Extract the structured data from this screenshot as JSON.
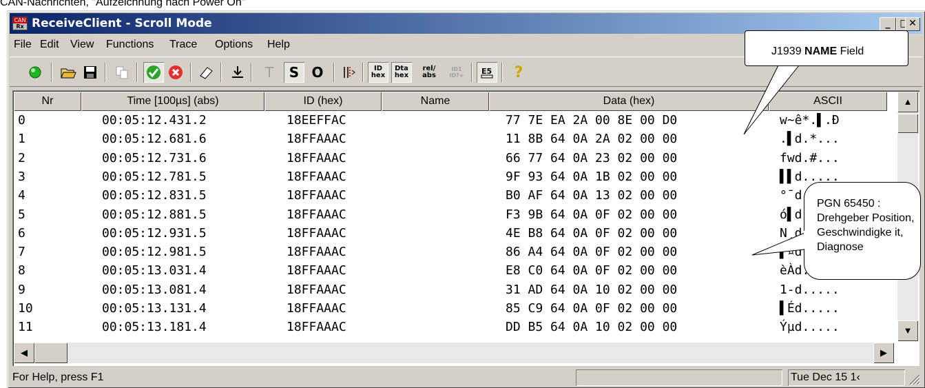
{
  "caption": "CAN-Nachrichten, \"Aufzeichnung nach Power On\"",
  "window": {
    "title": "ReceiveClient - Scroll Mode",
    "icon_text_top": "CAN",
    "icon_text_bottom": "Rx",
    "btn_minimize": "_",
    "btn_maximize": "□",
    "btn_close": "✕"
  },
  "menu": [
    "File",
    "Edit",
    "View",
    "Functions",
    "Trace",
    "Options",
    "Help"
  ],
  "toolbar": {
    "t_label": "T",
    "s_label": "S",
    "o_label": "O",
    "id_hex": [
      "ID",
      "hex"
    ],
    "dta_hex": [
      "Dta",
      "hex"
    ],
    "rel_abs": [
      "rel/",
      "abs"
    ],
    "id_plus": [
      "ID1",
      "ID?+"
    ],
    "help_glyph": "?"
  },
  "table": {
    "columns": [
      "Nr",
      "Time [100µs] (abs)",
      "ID (hex)",
      "Name",
      "Data (hex)",
      "ASCII"
    ],
    "rows": [
      {
        "nr": "0",
        "time": "00:05:12.431.2",
        "id": "18EEFFAC",
        "name": "",
        "data": "77 7E EA 2A 00 8E 00 D0",
        "ascii": "w~ê*.▌.Ð"
      },
      {
        "nr": "1",
        "time": "00:05:12.681.6",
        "id": "18FFAAAC",
        "name": "",
        "data": "11 8B 64 0A 2A 02 00 00",
        "ascii": ".▌d.*..."
      },
      {
        "nr": "2",
        "time": "00:05:12.731.6",
        "id": "18FFAAAC",
        "name": "",
        "data": "66 77 64 0A 23 02 00 00",
        "ascii": "fwd.#..."
      },
      {
        "nr": "3",
        "time": "00:05:12.781.5",
        "id": "18FFAAAC",
        "name": "",
        "data": "9F 93 64 0A 1B 02 00 00",
        "ascii": "▌▌d....."
      },
      {
        "nr": "4",
        "time": "00:05:12.831.5",
        "id": "18FFAAAC",
        "name": "",
        "data": "B0 AF 64 0A 13 02 00 00",
        "ascii": "°¯d....."
      },
      {
        "nr": "5",
        "time": "00:05:12.881.5",
        "id": "18FFAAAC",
        "name": "",
        "data": "F3 9B 64 0A 0F 02 00 00",
        "ascii": "ó▌d....."
      },
      {
        "nr": "6",
        "time": "00:05:12.931.5",
        "id": "18FFAAAC",
        "name": "",
        "data": "4E B8 64 0A 0F 02 00 00",
        "ascii": "N¸d....."
      },
      {
        "nr": "7",
        "time": "00:05:12.981.5",
        "id": "18FFAAAC",
        "name": "",
        "data": "86 A4 64 0A 0F 02 00 00",
        "ascii": "▌¤d....."
      },
      {
        "nr": "8",
        "time": "00:05:13.031.4",
        "id": "18FFAAAC",
        "name": "",
        "data": "E8 C0 64 0A 0F 02 00 00",
        "ascii": "èÀd....."
      },
      {
        "nr": "9",
        "time": "00:05:13.081.4",
        "id": "18FFAAAC",
        "name": "",
        "data": "31 AD 64 0A 10 02 00 00",
        "ascii": "1-d....."
      },
      {
        "nr": "10",
        "time": "00:05:13.131.4",
        "id": "18FFAAAC",
        "name": "",
        "data": "85 C9 64 0A 0F 02 00 00",
        "ascii": "▌Éd....."
      },
      {
        "nr": "11",
        "time": "00:05:13.181.4",
        "id": "18FFAAAC",
        "name": "",
        "data": "DD B5 64 0A 10 02 00 00",
        "ascii": "Ýµd....."
      }
    ]
  },
  "scroll": {
    "up": "▲",
    "down": "▼",
    "left": "◀",
    "right": "▶"
  },
  "status": {
    "help": "For Help, press F1",
    "datetime": "Tue Dec 15 1‹"
  },
  "callouts": {
    "name_field_prefix": "J1939 ",
    "name_field_bold": "NAME",
    "name_field_suffix": " Field",
    "pgn_text": "PGN 65450 : Drehgeber Position, Geschwindigke it, Diagnose"
  }
}
